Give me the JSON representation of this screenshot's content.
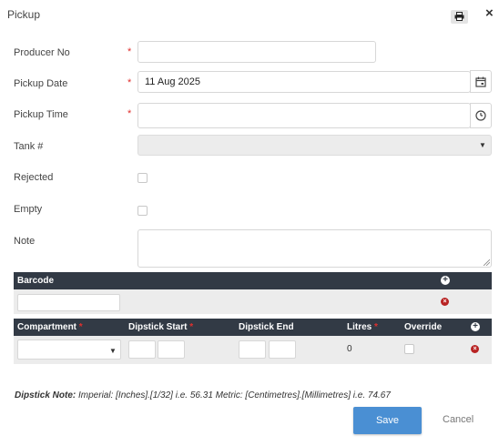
{
  "dialog": {
    "title": "Pickup",
    "print_icon": "printer-icon",
    "close_label": "×"
  },
  "form": {
    "producer_no": {
      "label": "Producer No",
      "value": ""
    },
    "pickup_date": {
      "label": "Pickup Date",
      "value": "11 Aug 2025",
      "icon": "calendar-icon"
    },
    "pickup_time": {
      "label": "Pickup Time",
      "value": "",
      "icon": "clock-icon"
    },
    "tank": {
      "label": "Tank #",
      "value": ""
    },
    "rejected": {
      "label": "Rejected",
      "checked": false
    },
    "empty": {
      "label": "Empty",
      "checked": false
    },
    "note": {
      "label": "Note",
      "value": ""
    },
    "required_mark": "*"
  },
  "barcode_table": {
    "header": "Barcode",
    "rows": [
      {
        "value": ""
      }
    ]
  },
  "compartment_table": {
    "headers": {
      "compartment": "Compartment",
      "dipstick_start": "Dipstick Start",
      "dipstick_end": "Dipstick End",
      "litres": "Litres",
      "override": "Override"
    },
    "required_mark": "*",
    "rows": [
      {
        "compartment": "",
        "litres": "0",
        "override": false
      }
    ]
  },
  "dipstick_note": {
    "label": "Dipstick Note:",
    "text": " Imperial: [Inches].[1/32] i.e. 56.31 Metric: [Centimetres].[Millimetres] i.e. 74.67"
  },
  "footer": {
    "save_label": "Save",
    "cancel_label": "Cancel"
  },
  "colors": {
    "accent": "#4a8fd3",
    "table_header": "#323a45",
    "required": "#e0302e",
    "delete": "#b82323"
  }
}
